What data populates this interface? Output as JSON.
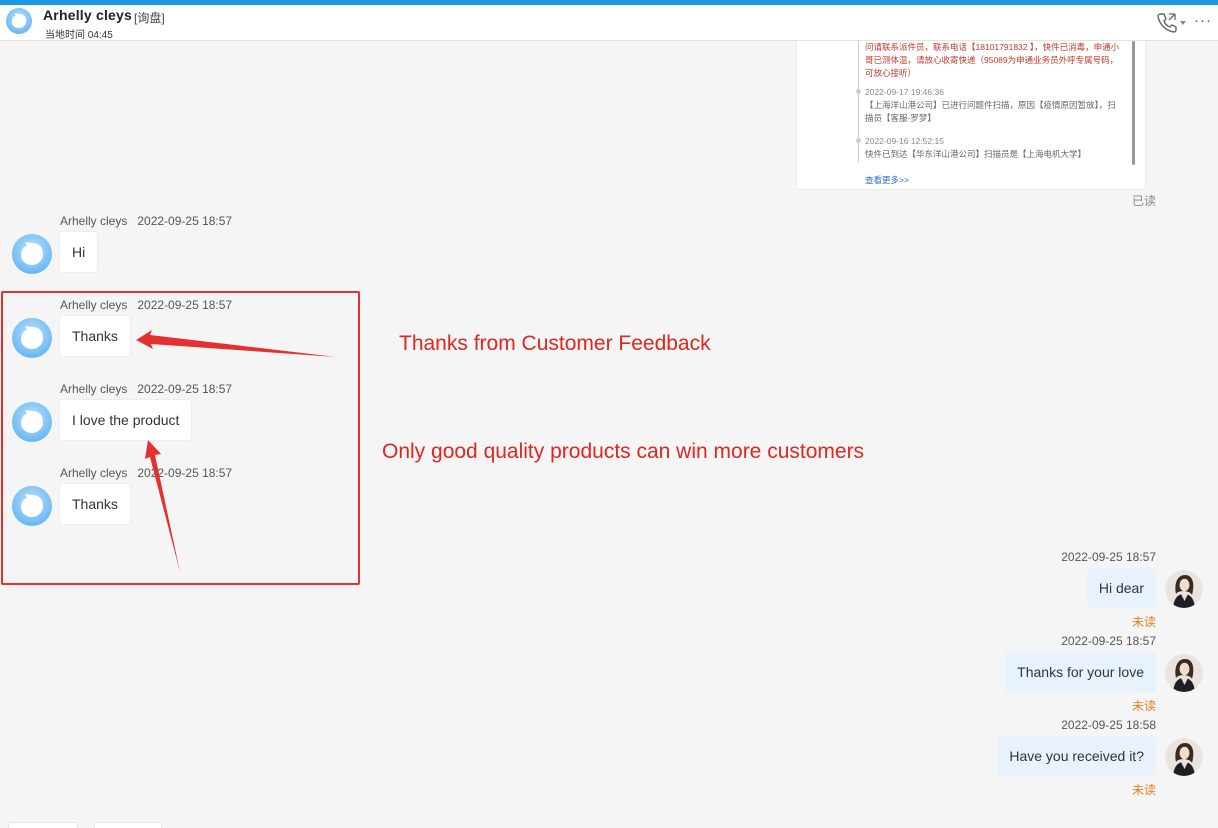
{
  "header": {
    "name": "Arhelly cleys",
    "tag": "[询盘]",
    "local_time": "当地时间 04:45",
    "more_label": "···"
  },
  "tracking_card": {
    "entries": [
      {
        "text": "问请联系派件员，联系电话【18101791832 】，快件已消毒，申通小哥已测体温，请放心收寄快递（95089为申通业务员外呼专属号码，可放心接听）"
      },
      {
        "date": "2022-09-17 19:46:36",
        "text": "【上海洋山港公司】已进行问题件扫描，原因【疫情原因暂放】，扫描员【客服-罗梦】"
      },
      {
        "date": "2022-09-16 12:52:15",
        "text": "快件已到达【华东洋山港公司】扫描员是【上海电机大学】"
      }
    ],
    "more_link": "查看更多>>"
  },
  "read_status": "已读",
  "incoming_messages": [
    {
      "sender": "Arhelly cleys",
      "time": "2022-09-25 18:57",
      "text": "Hi"
    },
    {
      "sender": "Arhelly cleys",
      "time": "2022-09-25 18:57",
      "text": "Thanks"
    },
    {
      "sender": "Arhelly cleys",
      "time": "2022-09-25 18:57",
      "text": "I love the product"
    },
    {
      "sender": "Arhelly cleys",
      "time": "2022-09-25 18:57",
      "text": "Thanks"
    }
  ],
  "outgoing_messages": [
    {
      "time": "2022-09-25 18:57",
      "text": "Hi dear",
      "status": "未读"
    },
    {
      "time": "2022-09-25 18:57",
      "text": "Thanks for your love",
      "status": "未读"
    },
    {
      "time": "2022-09-25 18:58",
      "text": "Have you received it?",
      "status": "未读"
    }
  ],
  "annotations": {
    "feedback_label": "Thanks from Customer Feedback",
    "quality_label": "Only good quality products can win more customers"
  },
  "colors": {
    "accent": "#1e96e6",
    "annotation_red": "#e0261f",
    "unread_orange": "#e67e22",
    "my_bubble": "#e8f2fd"
  },
  "icons": {
    "avatar": "bubble-avatar-icon",
    "phone": "phone-call-icon",
    "more": "more-dots-icon"
  }
}
